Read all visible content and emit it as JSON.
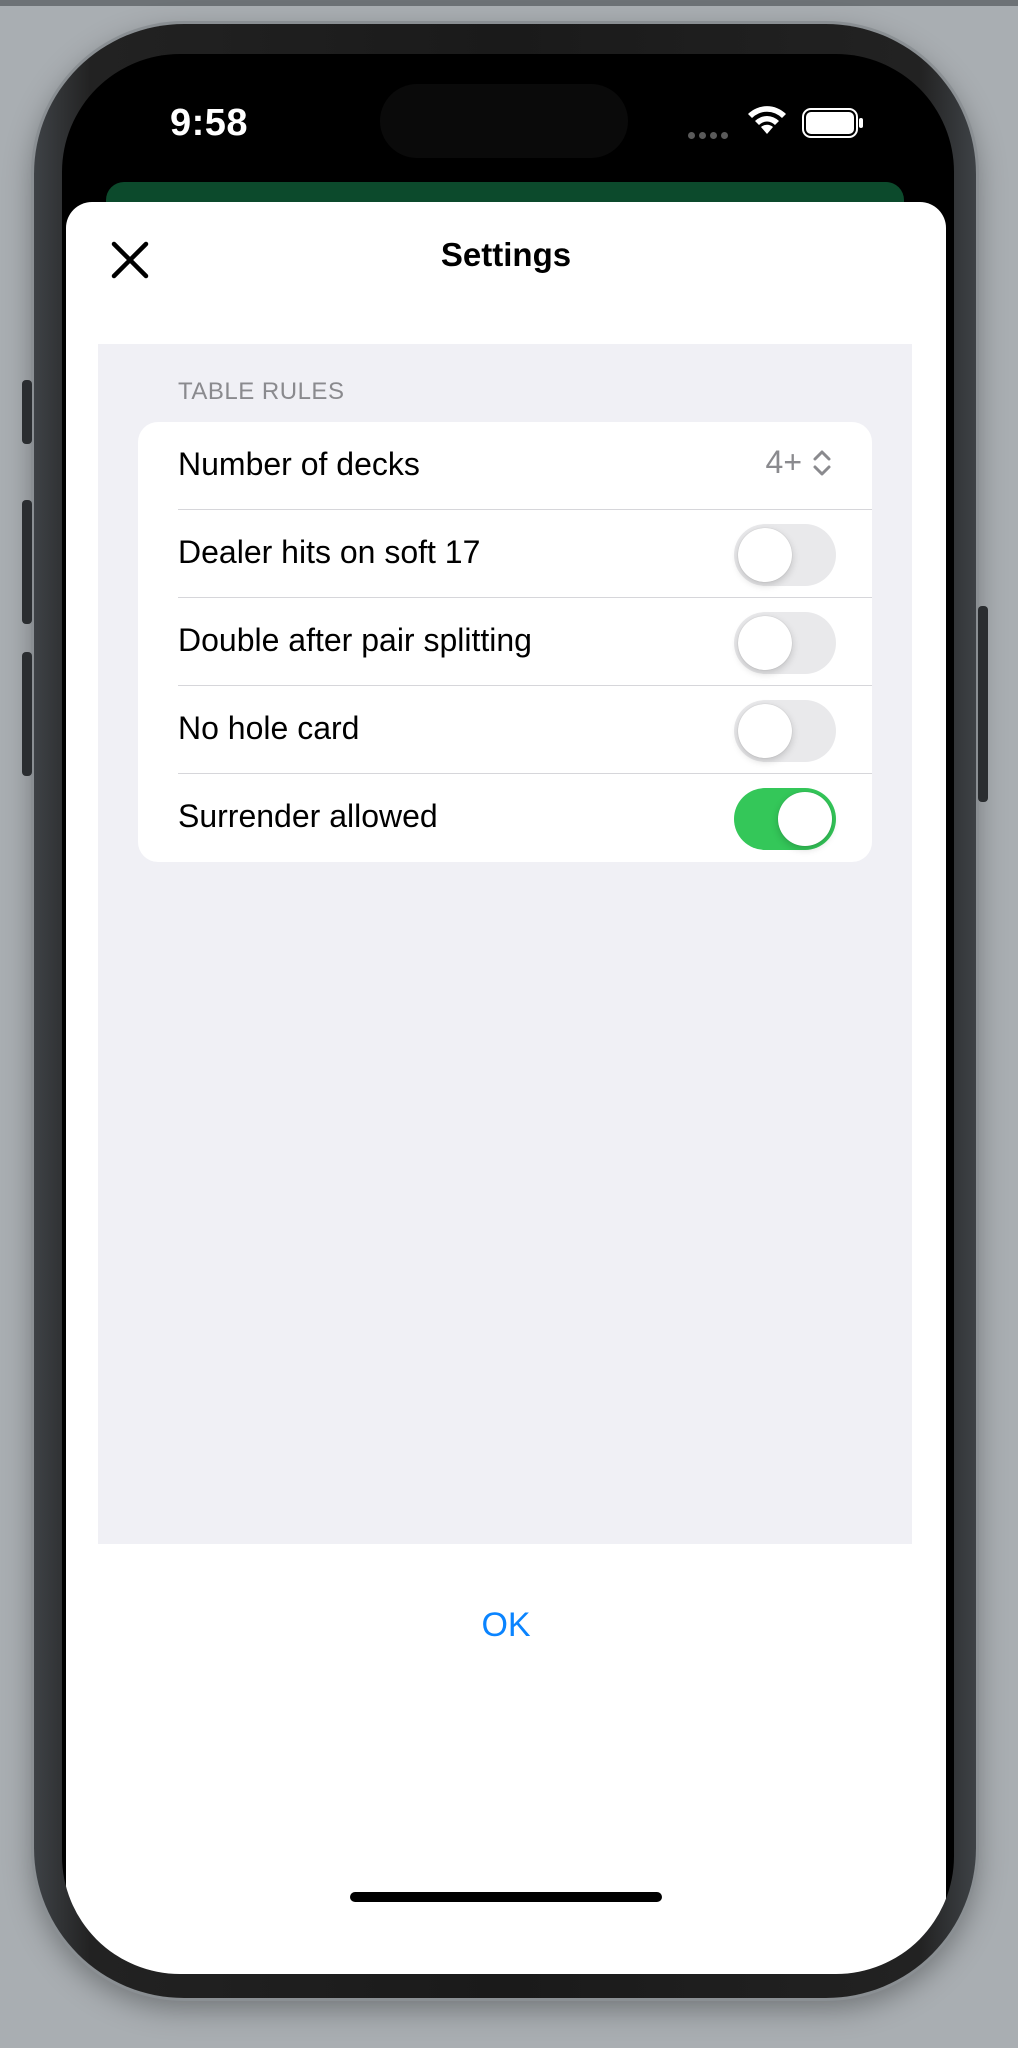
{
  "status_bar": {
    "time": "9:58"
  },
  "sheet": {
    "title": "Settings",
    "close_icon": "close-icon"
  },
  "section": {
    "header": "TABLE RULES"
  },
  "rules": {
    "number_of_decks": {
      "label": "Number of decks",
      "value": "4+",
      "icon": "chevron-up-down-icon"
    },
    "dealer_hits_soft_17": {
      "label": "Dealer hits on soft 17",
      "enabled": false
    },
    "double_after_split": {
      "label": "Double after pair splitting",
      "enabled": false
    },
    "no_hole_card": {
      "label": "No hole card",
      "enabled": false
    },
    "surrender_allowed": {
      "label": "Surrender allowed",
      "enabled": true
    }
  },
  "footer": {
    "ok_label": "OK"
  },
  "colors": {
    "accent": "#0a84ff",
    "toggle_on": "#34c759",
    "toggle_off": "#e9e9eb",
    "grouped_background": "#f0f0f5",
    "green_table": "#0c4a2c"
  }
}
